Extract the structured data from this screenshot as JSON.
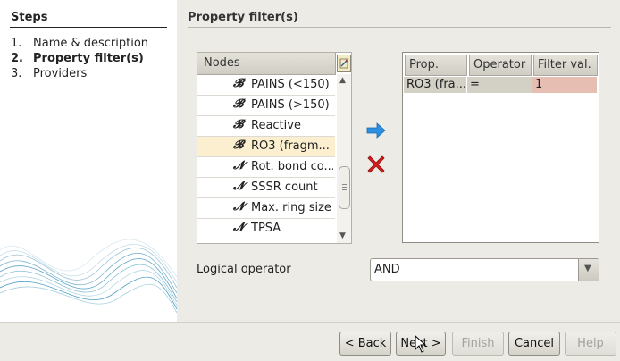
{
  "steps": {
    "title": "Steps",
    "items": [
      {
        "num": "1.",
        "label": "Name & description"
      },
      {
        "num": "2.",
        "label": "Property filter(s)"
      },
      {
        "num": "3.",
        "label": "Providers"
      }
    ]
  },
  "section_title": "Property filter(s)",
  "nodes": {
    "header": "Nodes",
    "rows": [
      {
        "icon": "𝓑",
        "label": "PAINS (<150)"
      },
      {
        "icon": "𝓑",
        "label": "PAINS (>150)"
      },
      {
        "icon": "𝓑",
        "label": "Reactive"
      },
      {
        "icon": "𝓑",
        "label": "RO3 (fragm..."
      },
      {
        "icon": "𝓝",
        "label": "Rot. bond co..."
      },
      {
        "icon": "𝓝",
        "label": "SSSR count"
      },
      {
        "icon": "𝓝",
        "label": "Max. ring size"
      },
      {
        "icon": "𝓝",
        "label": "TPSA"
      }
    ],
    "selected_index": 3
  },
  "filters": {
    "headers": {
      "prop": "Prop.",
      "operator": "Operator",
      "value": "Filter val."
    },
    "rows": [
      {
        "prop": "RO3 (fra...",
        "operator": "=",
        "value": "1"
      }
    ],
    "prop_cell_color": "#d3d0c6",
    "value_cell_color": "#e7beb2"
  },
  "logical": {
    "label": "Logical operator",
    "value": "AND"
  },
  "buttons": {
    "back": "< Back",
    "next": "Next >",
    "finish": "Finish",
    "cancel": "Cancel",
    "help": "Help"
  }
}
